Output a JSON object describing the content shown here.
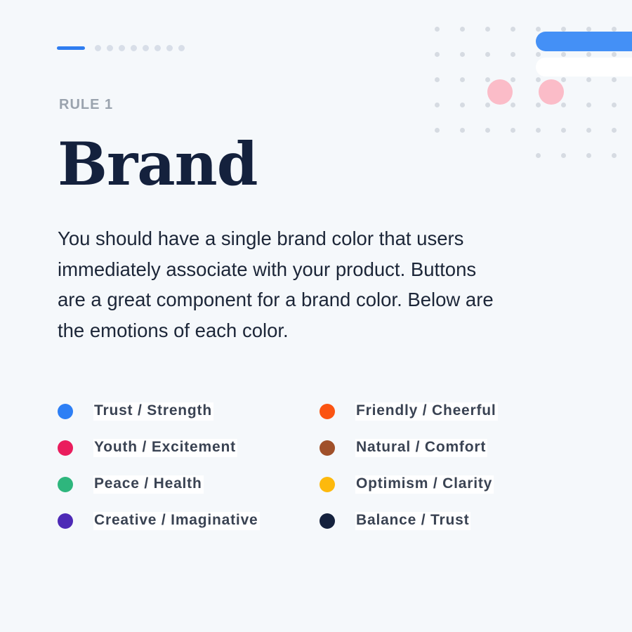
{
  "pager": {
    "total": 9,
    "active_index": 0,
    "active_color": "#2f7df0",
    "inactive_color": "#d8dee8"
  },
  "decoration": {
    "dot_color": "#d6dbe2",
    "bar_colors": [
      "#4490f6",
      "#ffffff"
    ],
    "circle_color": "#fbbcc8"
  },
  "eyebrow": "RULE 1",
  "title": "Brand",
  "body_lines": [
    "You should have a single brand color that users",
    "immediately associate with your product. Buttons",
    "are a great component for a brand color. Below are",
    "the emotions of each color."
  ],
  "legend": {
    "left": [
      {
        "label": "Trust / Strength",
        "color": "#2d7ff5"
      },
      {
        "label": "Youth / Excitement",
        "color": "#ea1d5d"
      },
      {
        "label": "Peace / Health",
        "color": "#2eb67d"
      },
      {
        "label": "Creative / Imaginative",
        "color": "#4d2ab6"
      }
    ],
    "right": [
      {
        "label": "Friendly / Cheerful",
        "color": "#fb5412"
      },
      {
        "label": "Natural / Comfort",
        "color": "#a0502a"
      },
      {
        "label": "Optimism / Clarity",
        "color": "#fdb90d"
      },
      {
        "label": "Balance / Trust",
        "color": "#14213d"
      }
    ]
  }
}
